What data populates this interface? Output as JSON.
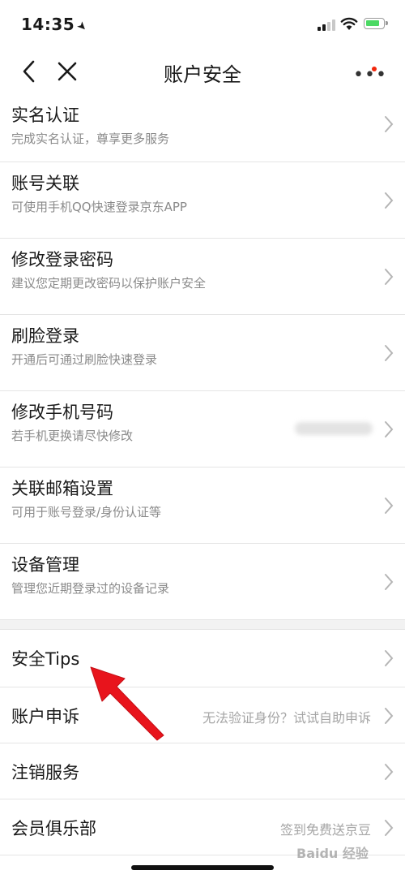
{
  "status_bar": {
    "time": "14:35",
    "location_glyph": "➤"
  },
  "nav": {
    "title": "账户安全"
  },
  "items": [
    {
      "title": "实名认证",
      "subtitle": "完成实名认证，尊享更多服务"
    },
    {
      "title": "账号关联",
      "subtitle": "可使用手机QQ快速登录京东APP"
    },
    {
      "title": "修改登录密码",
      "subtitle": "建议您定期更改密码以保护账户安全"
    },
    {
      "title": "刷脸登录",
      "subtitle": "开通后可通过刷脸快速登录"
    },
    {
      "title": "修改手机号码",
      "subtitle": "若手机更换请尽快修改"
    },
    {
      "title": "关联邮箱设置",
      "subtitle": "可用于账号登录/身份认证等"
    },
    {
      "title": "设备管理",
      "subtitle": "管理您近期登录过的设备记录"
    }
  ],
  "rows": [
    {
      "title": "安全Tips",
      "right": ""
    },
    {
      "title": "账户申诉",
      "right": "无法验证身份？试试自助申诉"
    },
    {
      "title": "注销服务",
      "right": ""
    },
    {
      "title": "会员俱乐部",
      "right": "签到免费送京豆"
    }
  ],
  "watermark": "Baidu 经验",
  "colors": {
    "accent_red": "#f2270c",
    "annotation_arrow": "#e8141c",
    "battery_green": "#4cd964"
  }
}
